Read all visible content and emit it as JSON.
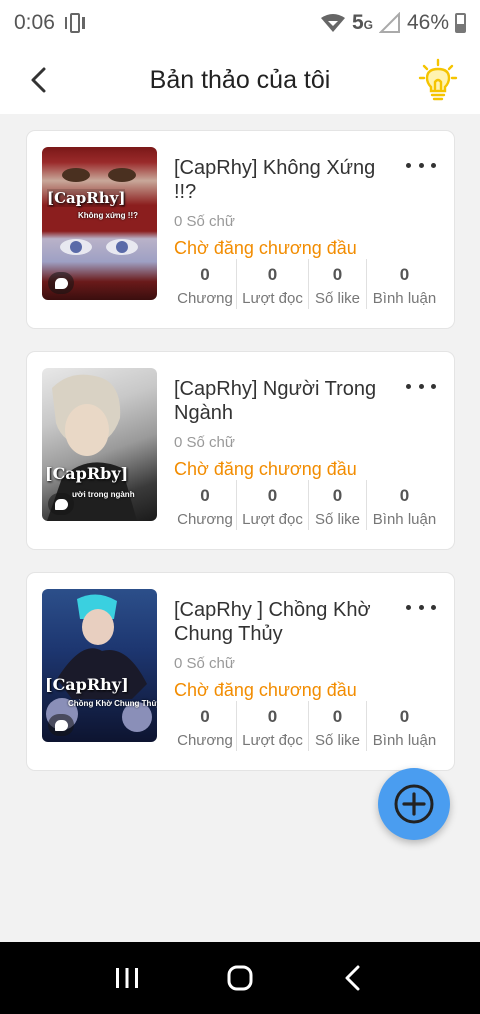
{
  "status_bar": {
    "time": "0:06",
    "network": "5",
    "network_sub": "G",
    "battery": "46%"
  },
  "header": {
    "title": "Bản thảo của tôi"
  },
  "stat_labels": {
    "chapters": "Chương",
    "reads": "Lượt đọc",
    "likes": "Số like",
    "comments": "Bình luận"
  },
  "stories": [
    {
      "title": "[CapRhy] Không Xứng !!?",
      "word_count": "0 Số chữ",
      "status": "Chờ đăng chương đầu",
      "chapters": "0",
      "reads": "0",
      "likes": "0",
      "comments": "0",
      "cover_text": "[CapRhy]",
      "cover_sub": "Không xứng !!?"
    },
    {
      "title": "[CapRhy] Người Trong Ngành",
      "word_count": "0 Số chữ",
      "status": "Chờ đăng chương đầu",
      "chapters": "0",
      "reads": "0",
      "likes": "0",
      "comments": "0",
      "cover_text": "[CapRby]",
      "cover_sub": "ười trong ngành"
    },
    {
      "title": "[CapRhy ] Chồng Khờ Chung Thủy",
      "word_count": "0 Số chữ",
      "status": "Chờ đăng chương đầu",
      "chapters": "0",
      "reads": "0",
      "likes": "0",
      "comments": "0",
      "cover_text": "[CapRhy]",
      "cover_sub": "Chồng Khờ Chung Thủy"
    }
  ],
  "colors": {
    "accent_orange": "#f28c00",
    "fab_blue": "#4a9df0"
  },
  "icons": {
    "back": "chevron-left-icon",
    "hint": "lightbulb-icon",
    "add": "plus-icon",
    "more": "more-horizontal-icon"
  }
}
